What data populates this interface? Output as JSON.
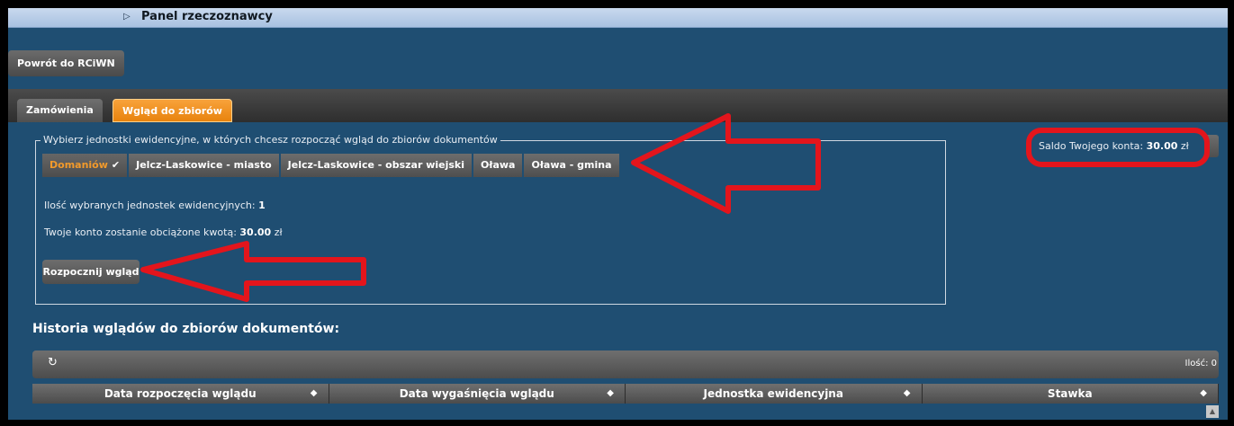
{
  "header": {
    "title": "Panel rzeczoznawcy",
    "toggle_icon": "triangle-right-icon"
  },
  "back_button": "Powrót do RCiWN",
  "tabs": [
    {
      "label": "Zamówienia",
      "active": false
    },
    {
      "label": "Wgląd do zbiorów",
      "active": true
    }
  ],
  "selection": {
    "legend": "Wybierz jednostki ewidencyjne, w których chcesz rozpocząć wgląd do zbiorów dokumentów",
    "units": [
      {
        "label": "Domaniów",
        "selected": true
      },
      {
        "label": "Jelcz-Laskowice - miasto",
        "selected": false
      },
      {
        "label": "Jelcz-Laskowice - obszar wiejski",
        "selected": false
      },
      {
        "label": "Oława",
        "selected": false
      },
      {
        "label": "Oława - gmina",
        "selected": false
      }
    ],
    "count_label": "Ilość wybranych jednostek ewidencyjnych:",
    "count_value": "1",
    "charge_label": "Twoje konto zostanie obciążone kwotą:",
    "charge_value": "30.00",
    "charge_currency": "zł",
    "start_button": "Rozpocznij wgląd"
  },
  "balance": {
    "label": "Saldo Twojego konta:",
    "value": "30.00",
    "currency": "zł"
  },
  "history": {
    "title": "Historia wglądów do zbiorów dokumentów:",
    "count_label": "Ilość: 0",
    "columns": [
      "Data rozpoczęcia wglądu",
      "Data wygaśnięcia wglądu",
      "Jednostka ewidencyjna",
      "Stawka"
    ]
  },
  "colors": {
    "accent": "#f29a2b",
    "background": "#1f4e72",
    "annotation": "#e3151c"
  }
}
